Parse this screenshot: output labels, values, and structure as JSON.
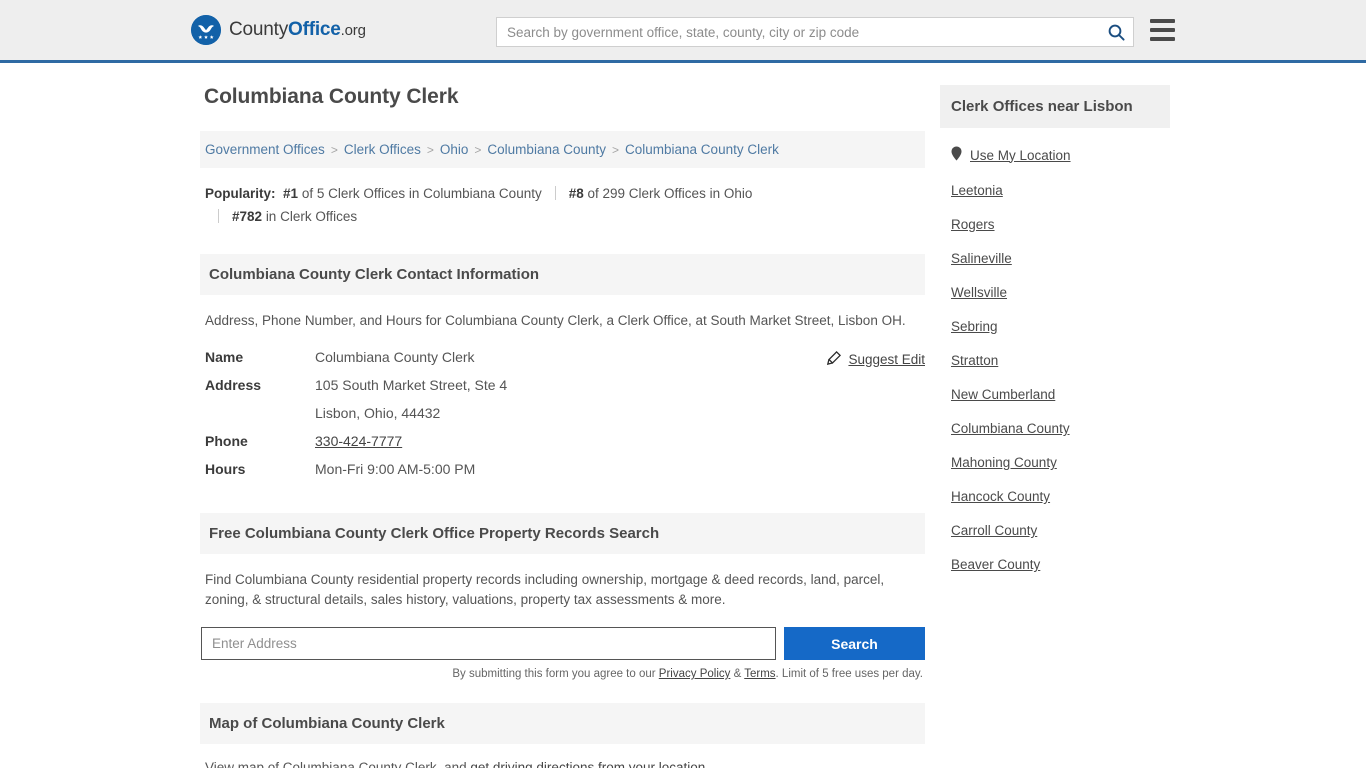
{
  "header": {
    "brand": {
      "part1": "County",
      "part2": "Office",
      "part3": ".org",
      "icon": "eagle-seal-logo"
    },
    "search": {
      "placeholder": "Search by government office, state, county, city or zip code",
      "value": "",
      "icon": "search-icon"
    },
    "menu_icon": "hamburger-menu-icon",
    "accent_color": "#2f6aa3"
  },
  "page_title": "Columbiana County Clerk",
  "breadcrumb": [
    "Government Offices",
    "Clerk Offices",
    "Ohio",
    "Columbiana County",
    "Columbiana County Clerk"
  ],
  "breadcrumb_separator": ">",
  "popularity": {
    "label": "Popularity:",
    "items": [
      {
        "rank": "#1",
        "text": "of 5 Clerk Offices in Columbiana County"
      },
      {
        "rank": "#8",
        "text": "of 299 Clerk Offices in Ohio"
      },
      {
        "rank": "#782",
        "text": "in Clerk Offices"
      }
    ]
  },
  "contact": {
    "heading": "Columbiana County Clerk Contact Information",
    "intro": "Address, Phone Number, and Hours for Columbiana County Clerk, a Clerk Office, at South Market Street, Lisbon OH.",
    "suggest_edit": {
      "label": "Suggest Edit",
      "icon": "edit-pencil-icon"
    },
    "rows": [
      {
        "label": "Name",
        "value": "Columbiana County Clerk",
        "link": false
      },
      {
        "label": "Address",
        "value": "105 South Market Street, Ste 4",
        "line2": "Lisbon, Ohio, 44432",
        "link": false
      },
      {
        "label": "Phone",
        "value": "330-424-7777",
        "link": true
      },
      {
        "label": "Hours",
        "value": "Mon-Fri 9:00 AM-5:00 PM",
        "link": false
      }
    ]
  },
  "property_search": {
    "heading": "Free Columbiana County Clerk Office Property Records Search",
    "description": "Find Columbiana County residential property records including ownership, mortgage & deed records, land, parcel, zoning, & structural details, sales history, valuations, property tax assessments & more.",
    "input_placeholder": "Enter Address",
    "input_value": "",
    "button_label": "Search",
    "button_color": "#1569c7",
    "disclaimer_pre": "By submitting this form you agree to our ",
    "disclaimer_privacy": "Privacy Policy",
    "disclaimer_amp": " & ",
    "disclaimer_terms": "Terms",
    "disclaimer_post": ". Limit of 5 free uses per day."
  },
  "map": {
    "heading": "Map of Columbiana County Clerk",
    "text_pre": "View map of Columbiana County Clerk, and ",
    "link": "get driving directions from your location",
    "text_post": "."
  },
  "sidebar": {
    "heading": "Clerk Offices near Lisbon",
    "use_my_location": {
      "label": "Use My Location",
      "icon": "map-pin-icon"
    },
    "items": [
      "Leetonia",
      "Rogers",
      "Salineville",
      "Wellsville",
      "Sebring",
      "Stratton",
      "New Cumberland",
      "Columbiana County",
      "Mahoning County",
      "Hancock County",
      "Carroll County",
      "Beaver County"
    ]
  }
}
